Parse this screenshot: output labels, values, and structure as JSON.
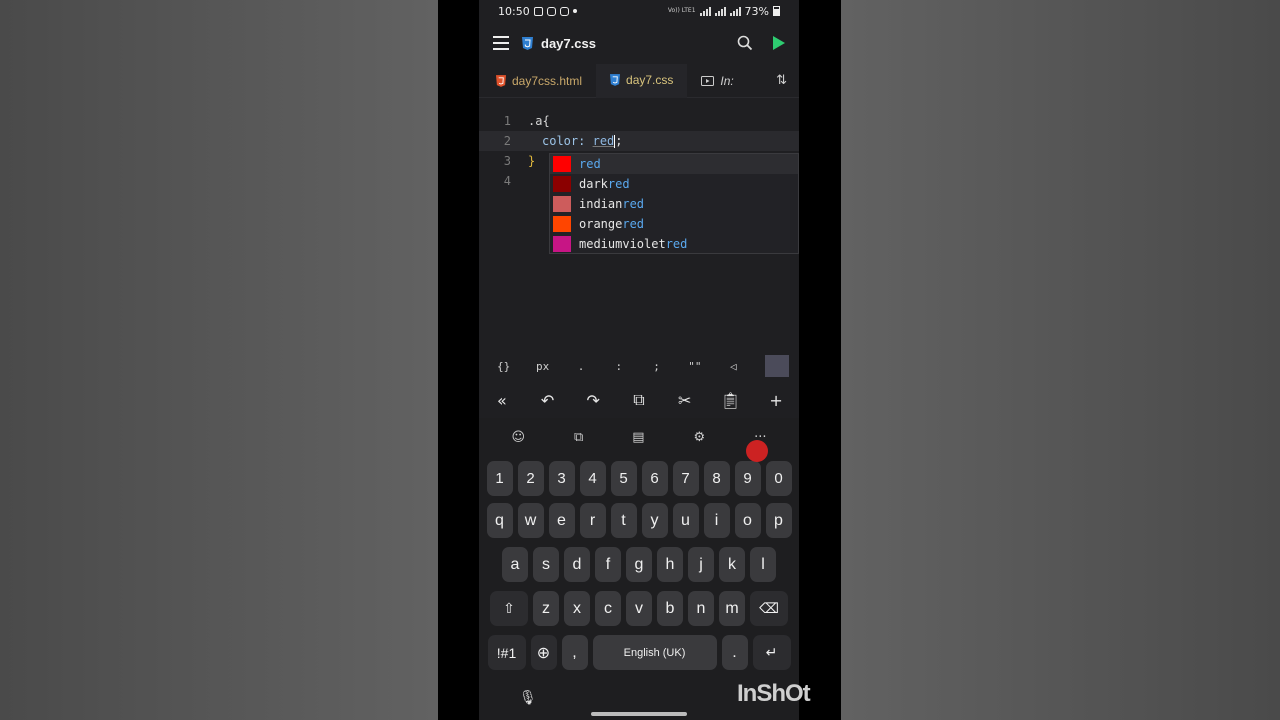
{
  "status": {
    "time": "10:50",
    "network_label": "Vo)) LTE1",
    "battery": "73%"
  },
  "appbar": {
    "title": "day7.css"
  },
  "tabs": [
    {
      "label": "day7css.html"
    },
    {
      "label": "day7.css"
    },
    {
      "label": "In:"
    }
  ],
  "editor": {
    "line_numbers": [
      "1",
      "2",
      "3",
      "4"
    ],
    "line1": ".a{",
    "line2_prop": "color:",
    "line2_val": "red",
    "line2_end": ";",
    "line3": "}"
  },
  "suggestions": [
    {
      "prefix": "",
      "match": "red",
      "color": "#ff0000"
    },
    {
      "prefix": "dark",
      "match": "red",
      "color": "#8b0000"
    },
    {
      "prefix": "indian",
      "match": "red",
      "color": "#cd5c5c"
    },
    {
      "prefix": "orange",
      "match": "red",
      "color": "#ff4500"
    },
    {
      "prefix": "mediumviolet",
      "match": "red",
      "color": "#c71585"
    }
  ],
  "symbols": [
    "{}",
    "px",
    ".",
    ":",
    ";",
    "\"\""
  ],
  "keyboard": {
    "numbers": [
      "1",
      "2",
      "3",
      "4",
      "5",
      "6",
      "7",
      "8",
      "9",
      "0"
    ],
    "row1": [
      "q",
      "w",
      "e",
      "r",
      "t",
      "y",
      "u",
      "i",
      "o",
      "p"
    ],
    "row2": [
      "a",
      "s",
      "d",
      "f",
      "g",
      "h",
      "j",
      "k",
      "l"
    ],
    "row3": [
      "z",
      "x",
      "c",
      "v",
      "b",
      "n",
      "m"
    ],
    "symbols_key": "!#1",
    "comma": ",",
    "space_label": "English (UK)",
    "period": "."
  },
  "watermark": "InShOt"
}
